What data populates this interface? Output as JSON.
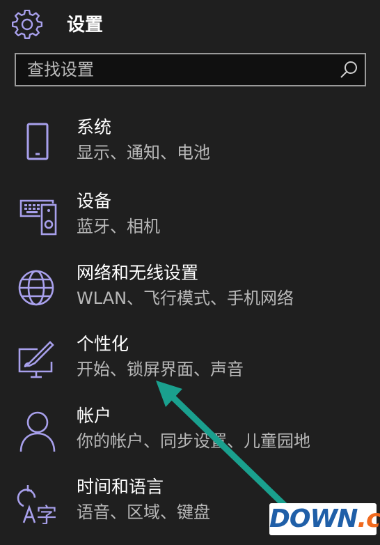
{
  "header": {
    "title": "设置",
    "icon": "gear-icon"
  },
  "search": {
    "placeholder": "查找设置",
    "icon": "search-icon"
  },
  "items": [
    {
      "name": "系统",
      "desc": "显示、通知、电池",
      "icon": "phone-icon"
    },
    {
      "name": "设备",
      "desc": "蓝牙、相机",
      "icon": "devices-icon"
    },
    {
      "name": "网络和无线设置",
      "desc": "WLAN、飞行模式、手机网络",
      "icon": "globe-icon"
    },
    {
      "name": "个性化",
      "desc": "开始、锁屏界面、声音",
      "icon": "personalization-icon"
    },
    {
      "name": "帐户",
      "desc": "你的帐户、同步设置、儿童园地",
      "icon": "person-icon"
    },
    {
      "name": "时间和语言",
      "desc": "语音、区域、键盘",
      "icon": "time-language-icon"
    }
  ],
  "colors": {
    "accent": "#a8a0ec",
    "background": "#1f1f1f",
    "arrow": "#1aa08e"
  },
  "watermark": {
    "part1": "DOWN",
    "part2": ".cc"
  }
}
